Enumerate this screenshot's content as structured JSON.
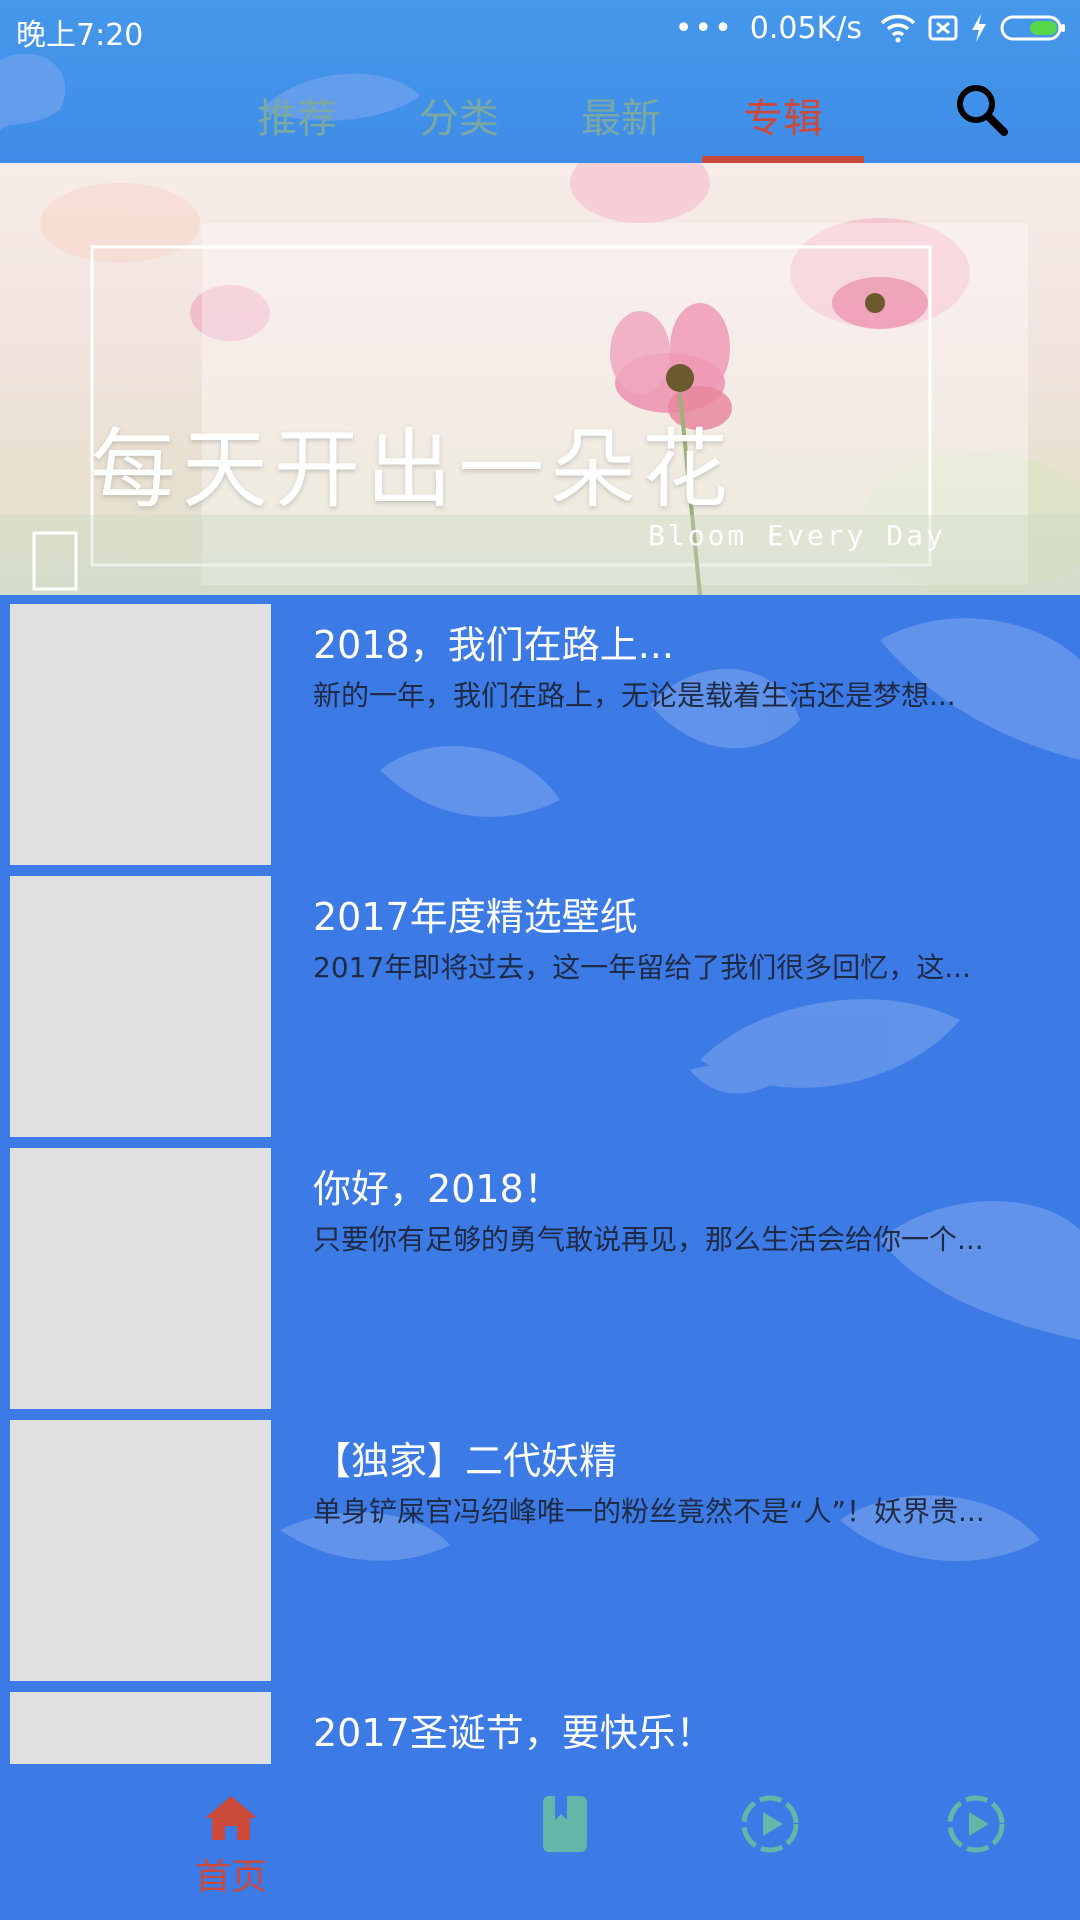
{
  "status_bar": {
    "time": "晚上7:20",
    "dots": "•••",
    "network_speed": "0.05K/s",
    "icons": [
      "wifi-icon",
      "sim-icon",
      "charging-icon",
      "battery-icon"
    ]
  },
  "top_tabs": {
    "items": [
      {
        "label": "推荐"
      },
      {
        "label": "分类"
      },
      {
        "label": "最新"
      },
      {
        "label": "专辑"
      }
    ],
    "active_index": 3,
    "search_icon": "search-icon"
  },
  "banner": {
    "caption": "每天开出一朵花",
    "subtitle": "Bloom Every Day"
  },
  "albums": [
    {
      "title": "2018，我们在路上...",
      "description": "新的一年，我们在路上，无论是载着生活还是梦想..."
    },
    {
      "title": "2017年度精选壁纸",
      "description": " 2017年即将过去，这一年留给了我们很多回忆，这..."
    },
    {
      "title": "你好，2018！",
      "description": "只要你有足够的勇气敢说再见，那么生活会给你一个..."
    },
    {
      "title": "【独家】二代妖精",
      "description": " 单身铲屎官冯绍峰唯一的粉丝竟然不是“人”！妖界贵..."
    },
    {
      "title": "2017圣诞节，要快乐！",
      "description": ""
    }
  ],
  "bottom_nav": {
    "items": [
      {
        "icon": "home-icon",
        "label": "首页"
      },
      {
        "icon": "book-icon",
        "label": ""
      },
      {
        "icon": "play-circle-icon",
        "label": ""
      },
      {
        "icon": "play-circle-icon",
        "label": ""
      }
    ],
    "active_index": 0
  },
  "colors": {
    "background": "#3c7ae6",
    "accent_active": "#cc4a3a",
    "tab_inactive": "#7aa8a2",
    "icon_teal": "#63b6a8",
    "thumb_placeholder": "#e0e0e0"
  }
}
